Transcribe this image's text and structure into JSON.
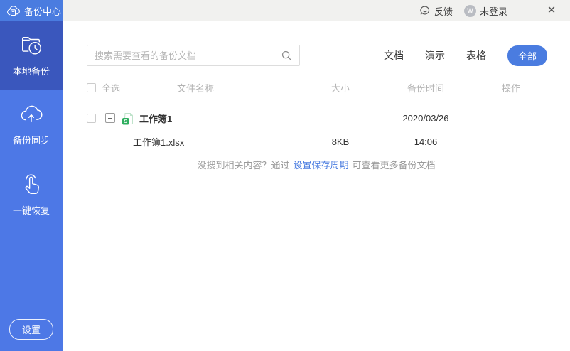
{
  "titlebar": {
    "app_title": "备份中心",
    "feedback_label": "反馈",
    "avatar_letter": "W",
    "login_status": "未登录",
    "minimize_glyph": "—",
    "close_glyph": "✕"
  },
  "sidebar": {
    "items": [
      {
        "label": "本地备份",
        "icon": "folder-clock",
        "active": true
      },
      {
        "label": "备份同步",
        "icon": "cloud-upload",
        "active": false
      },
      {
        "label": "一键恢复",
        "icon": "hand-click",
        "active": false
      }
    ],
    "settings_label": "设置"
  },
  "toolbar": {
    "search_placeholder": "搜索需要查看的备份文档",
    "search_value": "",
    "filters": [
      {
        "label": "文档",
        "active": false
      },
      {
        "label": "演示",
        "active": false
      },
      {
        "label": "表格",
        "active": false
      },
      {
        "label": "全部",
        "active": true
      }
    ]
  },
  "table": {
    "headers": {
      "select_all": "全选",
      "name": "文件名称",
      "size": "大小",
      "time": "备份时间",
      "action": "操作"
    },
    "groups": [
      {
        "name": "工作簿1",
        "date": "2020/03/26",
        "file_type_icon": "spreadsheet-file",
        "files": [
          {
            "name": "工作簿1.xlsx",
            "size": "8KB",
            "time": "14:06"
          }
        ]
      }
    ]
  },
  "hint": {
    "prefix": "没搜到相关内容？通过",
    "link": "设置保存周期",
    "suffix": "可查看更多备份文档"
  },
  "colors": {
    "accent_blue": "#4a7ce0",
    "sidebar_blue": "#4d78e6",
    "sidebar_active_blue": "#3a57bd",
    "titlebar_gray": "#f1f1ef",
    "header_text_gray": "#b3b3b3",
    "link_blue": "#4a7ce0",
    "file_icon_green": "#2fae5f"
  }
}
